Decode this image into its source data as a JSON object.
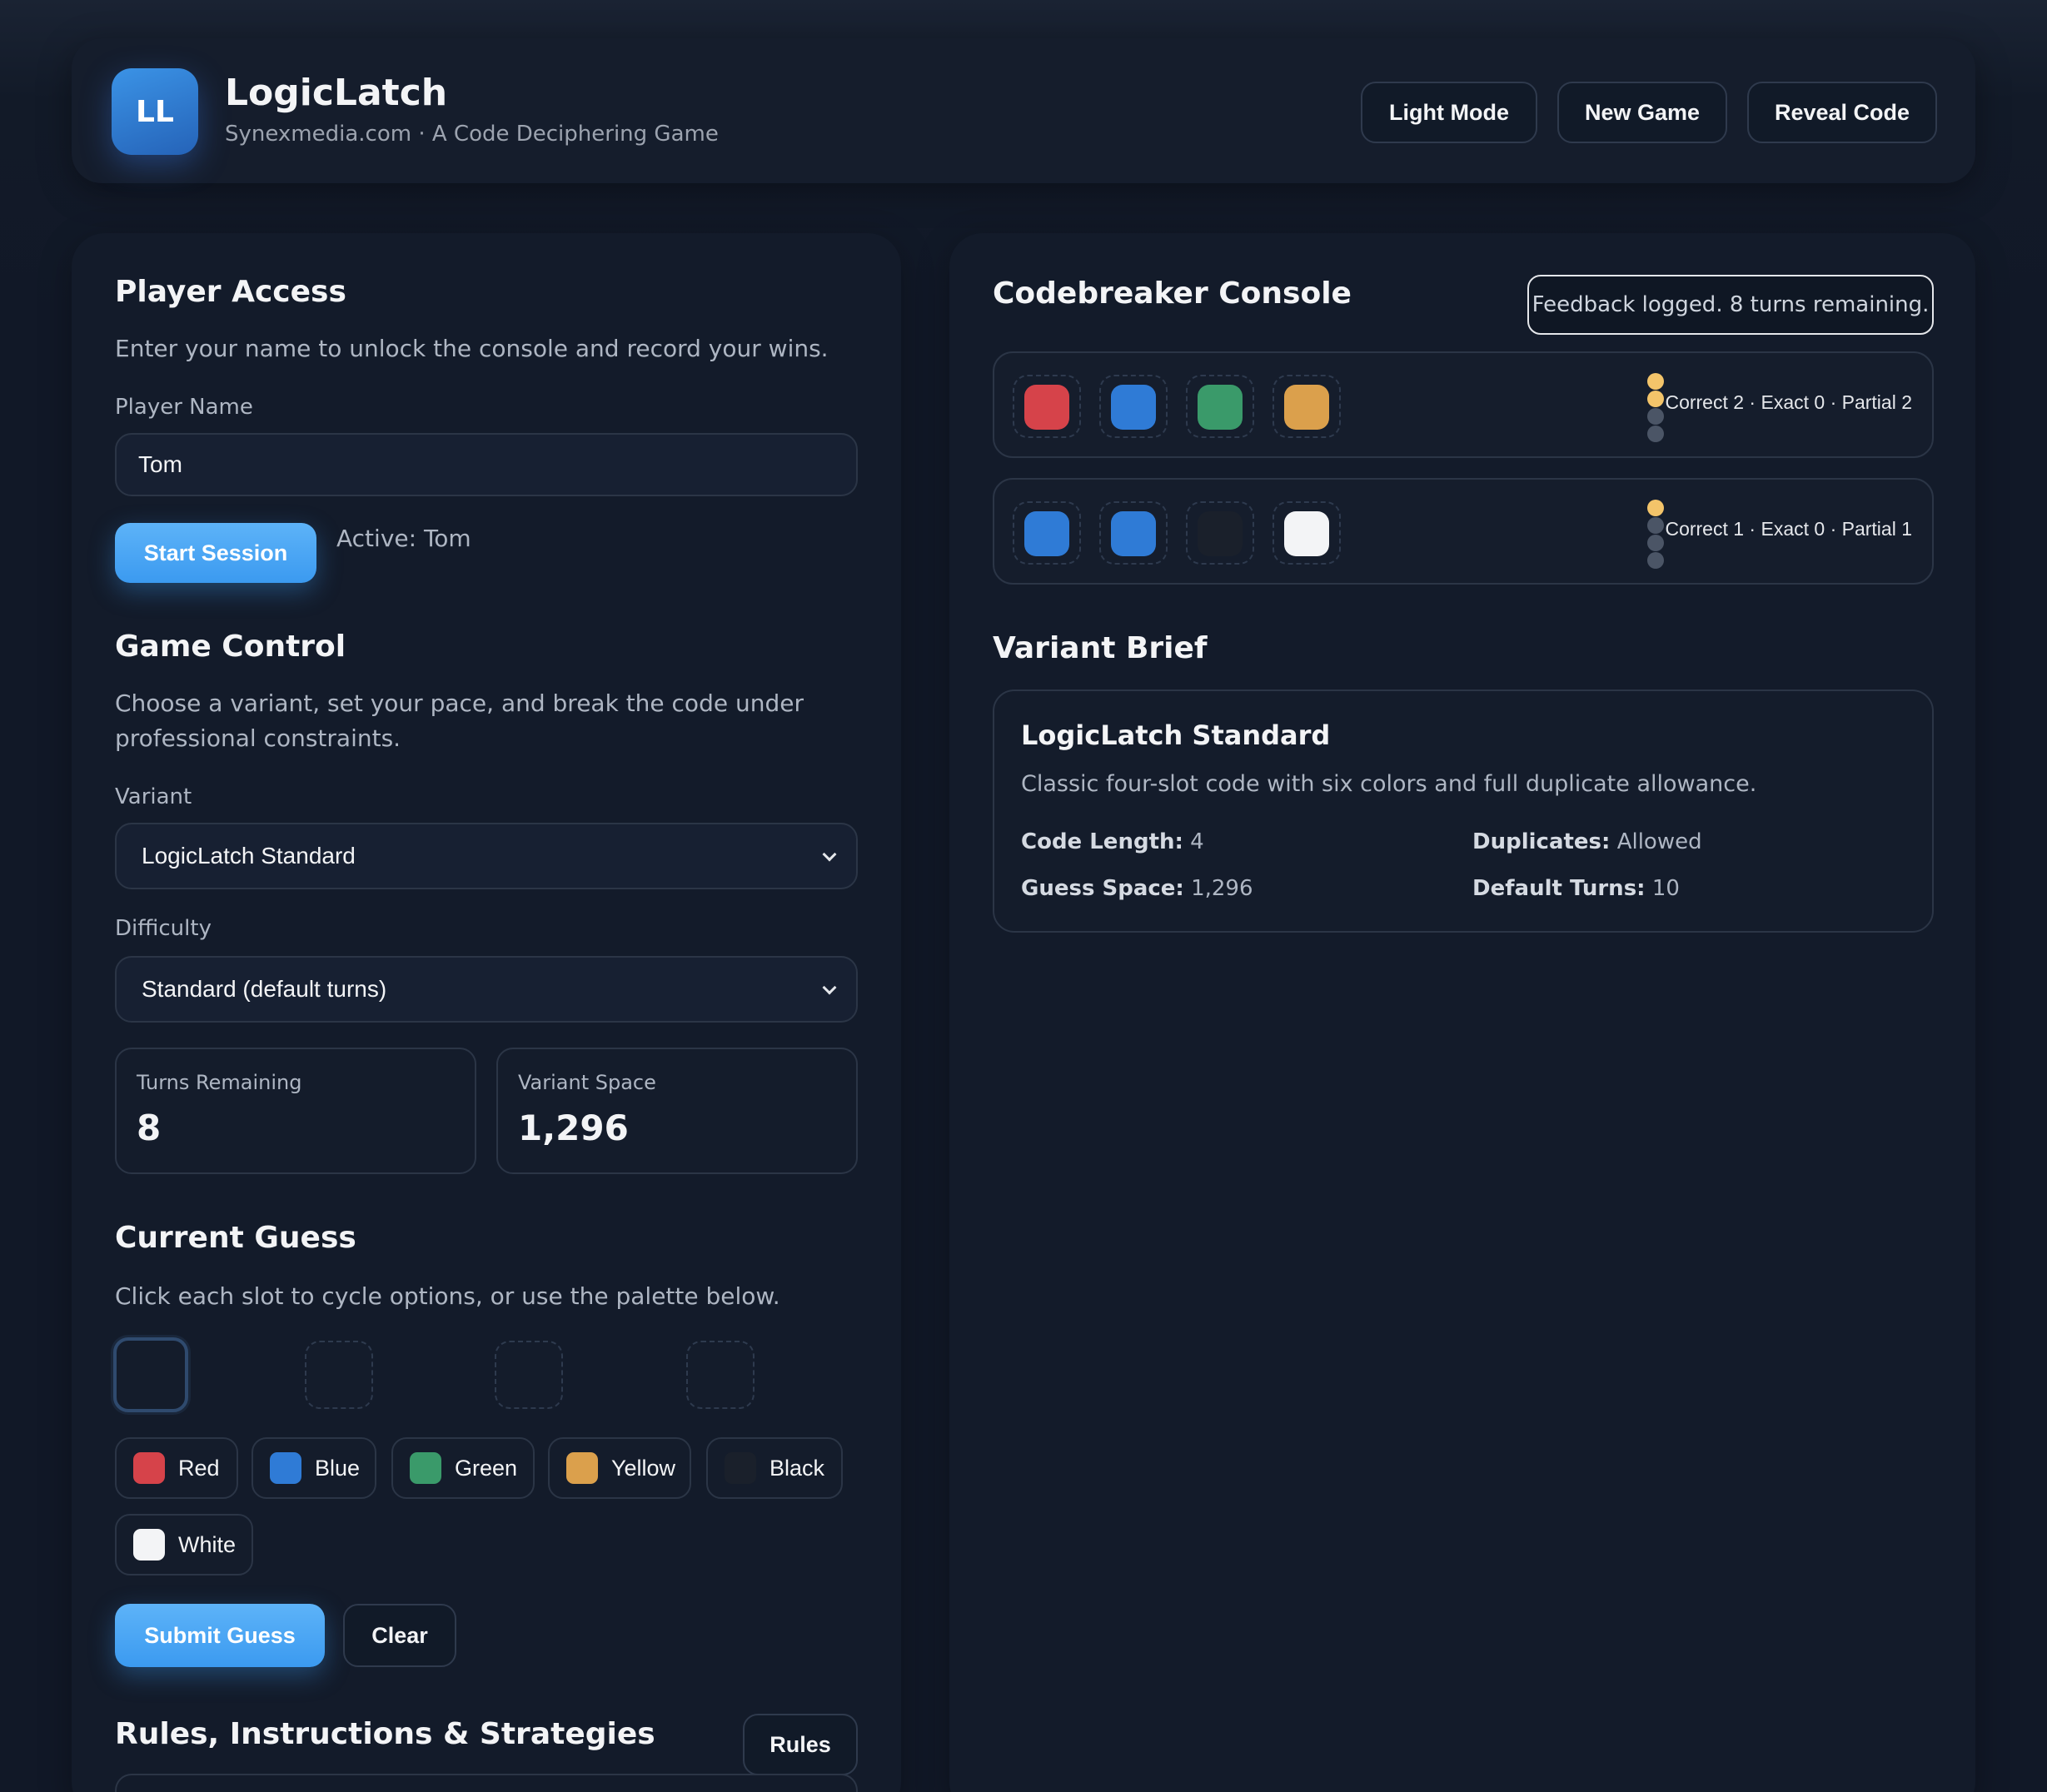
{
  "header": {
    "logo_text": "LL",
    "title": "LogicLatch",
    "subtitle": "Synexmedia.com · A Code Deciphering Game",
    "buttons": {
      "light_mode": "Light Mode",
      "new_game": "New Game",
      "reveal_code": "Reveal Code"
    }
  },
  "player_access": {
    "heading": "Player Access",
    "description": "Enter your name to unlock the console and record your wins.",
    "name_label": "Player Name",
    "name_value": "Tom",
    "start_button": "Start Session",
    "active_status": "Active: Tom"
  },
  "game_control": {
    "heading": "Game Control",
    "description_line1": "Choose a variant, set your pace, and break the code under",
    "description_line2": "professional constraints.",
    "variant_label": "Variant",
    "variant_value": "LogicLatch Standard",
    "difficulty_label": "Difficulty",
    "difficulty_value": "Standard (default turns)",
    "turns_remaining_label": "Turns Remaining",
    "turns_remaining_value": "8",
    "variant_space_label": "Variant Space",
    "variant_space_value": "1,296"
  },
  "current_guess": {
    "heading": "Current Guess",
    "description": "Click each slot to cycle options, or use the palette below.",
    "palette": [
      {
        "label": "Red",
        "color": "#d6434a"
      },
      {
        "label": "Blue",
        "color": "#2f7bd6"
      },
      {
        "label": "Green",
        "color": "#3a9a6a"
      },
      {
        "label": "Yellow",
        "color": "#dba04c"
      },
      {
        "label": "Black",
        "color": "#1a202b"
      },
      {
        "label": "White",
        "color": "#f3f4f6"
      }
    ],
    "submit_button": "Submit Guess",
    "clear_button": "Clear"
  },
  "rules": {
    "heading": "Rules, Instructions & Strategies",
    "button": "Rules"
  },
  "console": {
    "heading": "Codebreaker Console",
    "status": "Feedback logged. 8 turns remaining.",
    "rows": [
      {
        "pegs": [
          "#d6434a",
          "#2f7bd6",
          "#3a9a6a",
          "#dba04c"
        ],
        "keys": [
          "#f3c46a",
          "#f3c46a",
          "#4b5566",
          "#4b5566"
        ],
        "feedback": "Correct 2 · Exact 0 · Partial 2"
      },
      {
        "pegs": [
          "#2f7bd6",
          "#2f7bd6",
          "#1a202b",
          "#f3f4f6"
        ],
        "keys": [
          "#f3c46a",
          "#4b5566",
          "#4b5566",
          "#4b5566"
        ],
        "feedback": "Correct 1 · Exact 0 · Partial 1"
      }
    ]
  },
  "variant_brief": {
    "heading": "Variant Brief",
    "title": "LogicLatch Standard",
    "description": "Classic four-slot code with six colors and full duplicate allowance.",
    "code_length_label": "Code Length:",
    "code_length_value": "4",
    "duplicates_label": "Duplicates:",
    "duplicates_value": "Allowed",
    "guess_space_label": "Guess Space:",
    "guess_space_value": "1,296",
    "default_turns_label": "Default Turns:",
    "default_turns_value": "10"
  }
}
